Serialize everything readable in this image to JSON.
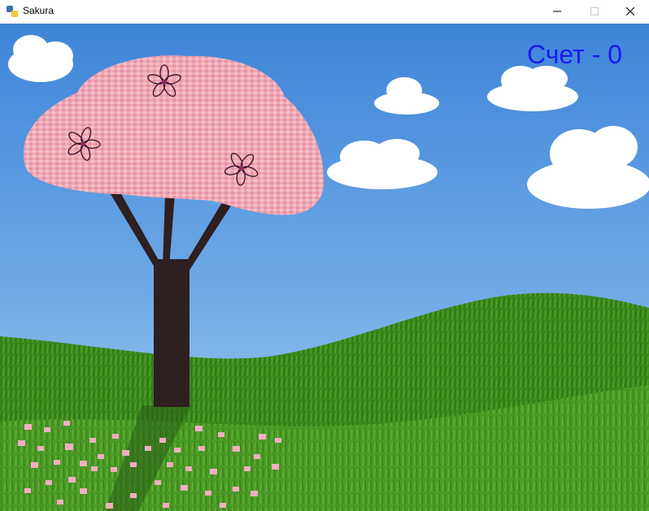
{
  "window": {
    "title": "Sakura",
    "icon": "python-icon",
    "controls": [
      "minimize-icon",
      "maximize-icon",
      "close-icon"
    ]
  },
  "hud": {
    "score": "Счет - 0",
    "score_color": "#1a1af0"
  },
  "scene": {
    "sky_color_top": "#3f86da",
    "sky_color_bottom": "#9cc8f0",
    "grass_color": "#3f8a1e",
    "blossom_color": "#f0a8b4",
    "trunk_color": "#2e1f1f",
    "flowers_on_tree": 3
  }
}
